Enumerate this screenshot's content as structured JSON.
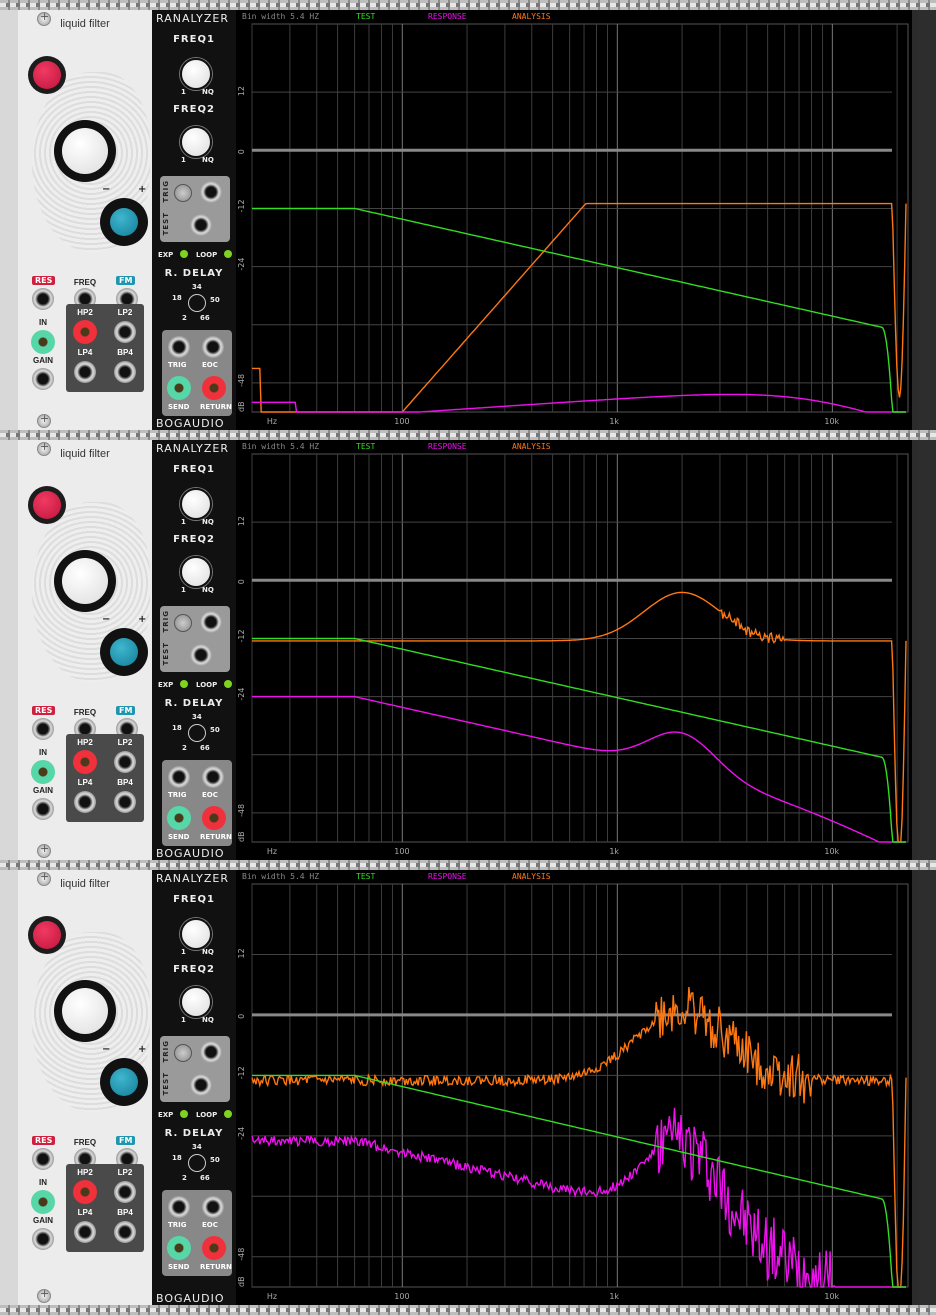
{
  "rows": [
    {
      "filter": {
        "title": "liquid filter",
        "labels": {
          "res": "RES",
          "freq": "FREQ",
          "fm": "FM",
          "in": "IN",
          "gain": "GAIN",
          "hp2": "HP2",
          "lp2": "LP2",
          "lp4": "LP4",
          "bp4": "BP4"
        },
        "minus": "−",
        "plus": "+"
      },
      "analyzer": {
        "brand_top": "RANALYZER",
        "freq1": "FREQ1",
        "freq2": "FREQ2",
        "range": {
          "min": "1",
          "max": "NQ"
        },
        "trig": "TRIG",
        "test": "TEST",
        "exp": "EXP",
        "loop": "LOOP",
        "rdelay": "R. DELAY",
        "delay_ticks": {
          "a": "34",
          "b": "18",
          "c": "50",
          "d": "2",
          "e": "66"
        },
        "jacks": {
          "trig": "TRIG",
          "eoc": "EOC",
          "send": "SEND",
          "return": "RETURN"
        },
        "brand_bottom": "BOGAUDIO"
      },
      "display": {
        "bin_width": "Bin width 5.4 HZ",
        "legend": {
          "test": "TEST",
          "response": "RESPONSE",
          "analysis": "ANALYSIS"
        },
        "y_ticks": [
          "12",
          "0",
          "-12",
          "-24",
          "-48",
          "dB"
        ],
        "x_ticks": [
          "Hz",
          "100",
          "1k",
          "10k"
        ]
      }
    },
    {
      "filter": {
        "title": "liquid filter",
        "labels": {
          "res": "RES",
          "freq": "FREQ",
          "fm": "FM",
          "in": "IN",
          "gain": "GAIN",
          "hp2": "HP2",
          "lp2": "LP2",
          "lp4": "LP4",
          "bp4": "BP4"
        },
        "minus": "−",
        "plus": "+"
      },
      "analyzer": {
        "brand_top": "RANALYZER",
        "freq1": "FREQ1",
        "freq2": "FREQ2",
        "range": {
          "min": "1",
          "max": "NQ"
        },
        "trig": "TRIG",
        "test": "TEST",
        "exp": "EXP",
        "loop": "LOOP",
        "rdelay": "R. DELAY",
        "delay_ticks": {
          "a": "34",
          "b": "18",
          "c": "50",
          "d": "2",
          "e": "66"
        },
        "jacks": {
          "trig": "TRIG",
          "eoc": "EOC",
          "send": "SEND",
          "return": "RETURN"
        },
        "brand_bottom": "BOGAUDIO"
      },
      "display": {
        "bin_width": "Bin width 5.4 HZ",
        "legend": {
          "test": "TEST",
          "response": "RESPONSE",
          "analysis": "ANALYSIS"
        },
        "y_ticks": [
          "12",
          "0",
          "-12",
          "-24",
          "-48",
          "dB"
        ],
        "x_ticks": [
          "Hz",
          "100",
          "1k",
          "10k"
        ]
      }
    },
    {
      "filter": {
        "title": "liquid filter",
        "labels": {
          "res": "RES",
          "freq": "FREQ",
          "fm": "FM",
          "in": "IN",
          "gain": "GAIN",
          "hp2": "HP2",
          "lp2": "LP2",
          "lp4": "LP4",
          "bp4": "BP4"
        },
        "minus": "−",
        "plus": "+"
      },
      "analyzer": {
        "brand_top": "RANALYZER",
        "freq1": "FREQ1",
        "freq2": "FREQ2",
        "range": {
          "min": "1",
          "max": "NQ"
        },
        "trig": "TRIG",
        "test": "TEST",
        "exp": "EXP",
        "loop": "LOOP",
        "rdelay": "R. DELAY",
        "delay_ticks": {
          "a": "34",
          "b": "18",
          "c": "50",
          "d": "2",
          "e": "66"
        },
        "jacks": {
          "trig": "TRIG",
          "eoc": "EOC",
          "send": "SEND",
          "return": "RETURN"
        },
        "brand_bottom": "BOGAUDIO"
      },
      "display": {
        "bin_width": "Bin width 5.4 HZ",
        "legend": {
          "test": "TEST",
          "response": "RESPONSE",
          "analysis": "ANALYSIS"
        },
        "y_ticks": [
          "12",
          "0",
          "-12",
          "-24",
          "-48",
          "dB"
        ],
        "x_ticks": [
          "Hz",
          "100",
          "1k",
          "10k"
        ]
      }
    }
  ],
  "colors": {
    "test": "#33dd22",
    "response": "#ee11ee",
    "analysis": "#ff7711",
    "res_tag": "#d0203f",
    "fm_tag": "#1f96b0"
  }
}
